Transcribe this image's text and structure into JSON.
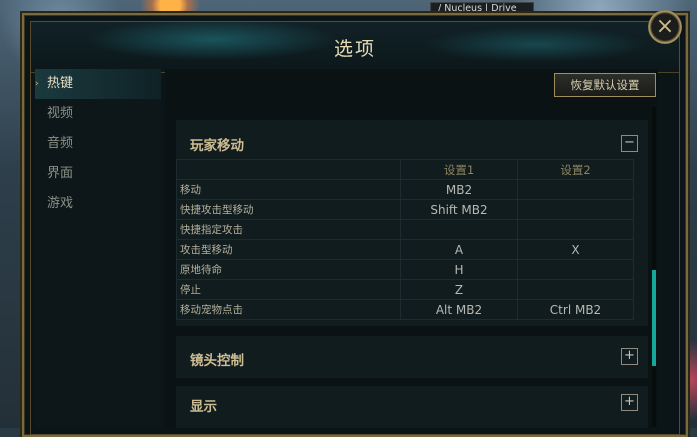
{
  "hud": {
    "top_label": "/ Nucleus | Drive"
  },
  "dialog": {
    "title": "选项",
    "close_label": "×"
  },
  "nav": {
    "items": [
      {
        "label": "热键",
        "active": true
      },
      {
        "label": "视频",
        "active": false
      },
      {
        "label": "音频",
        "active": false
      },
      {
        "label": "界面",
        "active": false
      },
      {
        "label": "游戏",
        "active": false
      }
    ],
    "active_marker": "›"
  },
  "content": {
    "reset_label": "恢复默认设置",
    "scroll_position_fraction": 0.55,
    "sections": [
      {
        "title": "玩家移动",
        "expanded": true,
        "toggle": "−",
        "columns": [
          "设置1",
          "设置2"
        ],
        "rows": [
          {
            "action": "移动",
            "slot1": "MB2",
            "slot2": ""
          },
          {
            "action": "快捷攻击型移动",
            "slot1": "Shift  MB2",
            "slot2": ""
          },
          {
            "action": "快捷指定攻击",
            "slot1": "",
            "slot2": ""
          },
          {
            "action": "攻击型移动",
            "slot1": "A",
            "slot2": "X"
          },
          {
            "action": "原地待命",
            "slot1": "H",
            "slot2": ""
          },
          {
            "action": "停止",
            "slot1": "Z",
            "slot2": ""
          },
          {
            "action": "移动宠物点击",
            "slot1": "Alt  MB2",
            "slot2": "Ctrl  MB2"
          }
        ]
      },
      {
        "title": "镜头控制",
        "expanded": false,
        "toggle": "+"
      },
      {
        "title": "显示",
        "expanded": false,
        "toggle": "+"
      }
    ]
  },
  "colors": {
    "accent_teal": "#14a79a",
    "gold_border": "#a18d5b",
    "section_title": "#cdbd92"
  }
}
